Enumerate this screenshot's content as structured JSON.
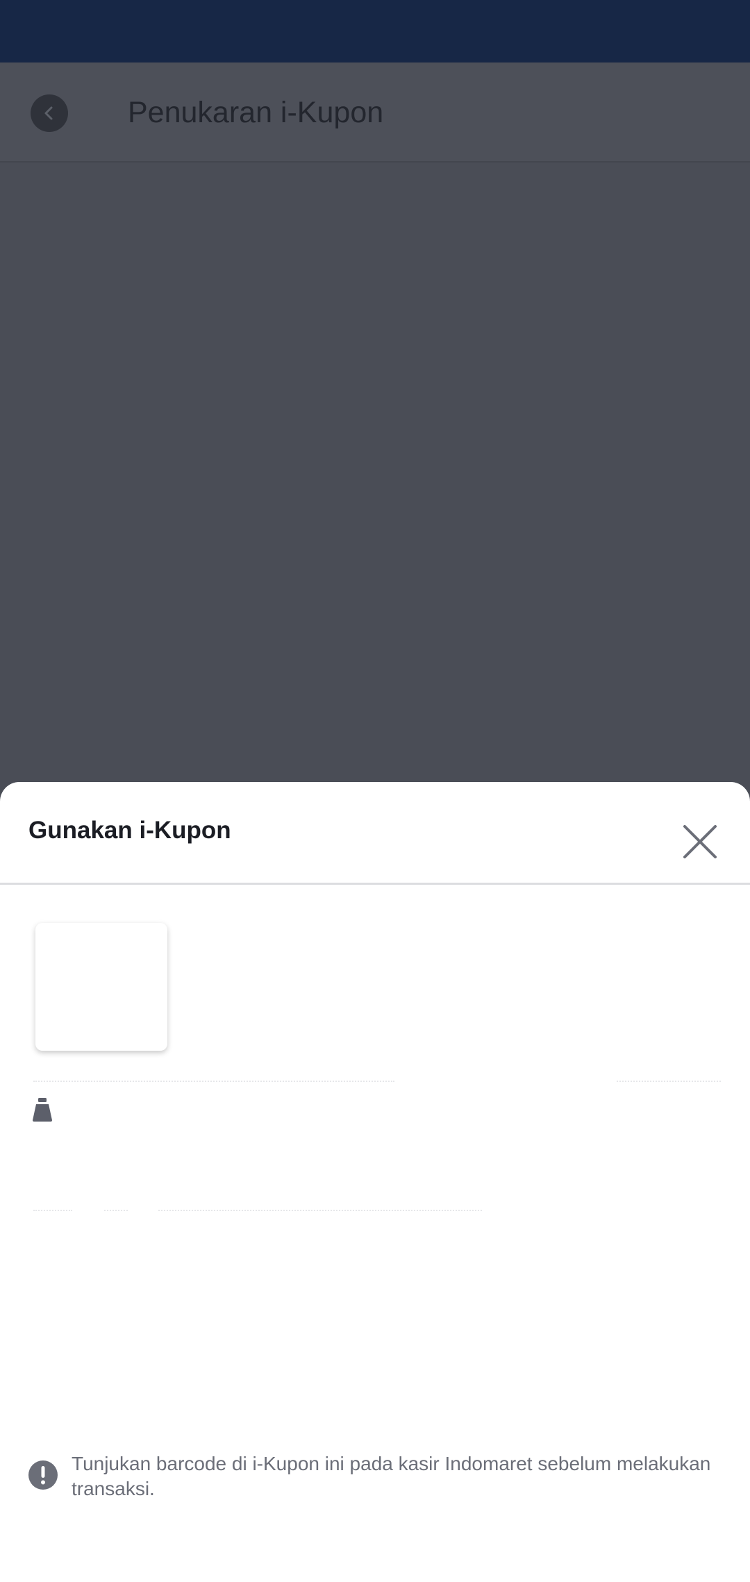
{
  "header": {
    "title": "Penukaran i-Kupon",
    "back_icon": "chevron-left-icon"
  },
  "sheet": {
    "title": "Gunakan i-Kupon",
    "close_icon": "close-icon",
    "info_icon": "exclamation-circle-icon",
    "info_text": "Tunjukan barcode di i-Kupon ini pada kasir Indomaret sebelum melakukan transaksi."
  },
  "colors": {
    "status_bar": "#172746",
    "overlay": "#4a4d56",
    "sheet_background": "#ffffff",
    "title_text": "#1b1d24",
    "muted_text": "#6b6e78"
  }
}
